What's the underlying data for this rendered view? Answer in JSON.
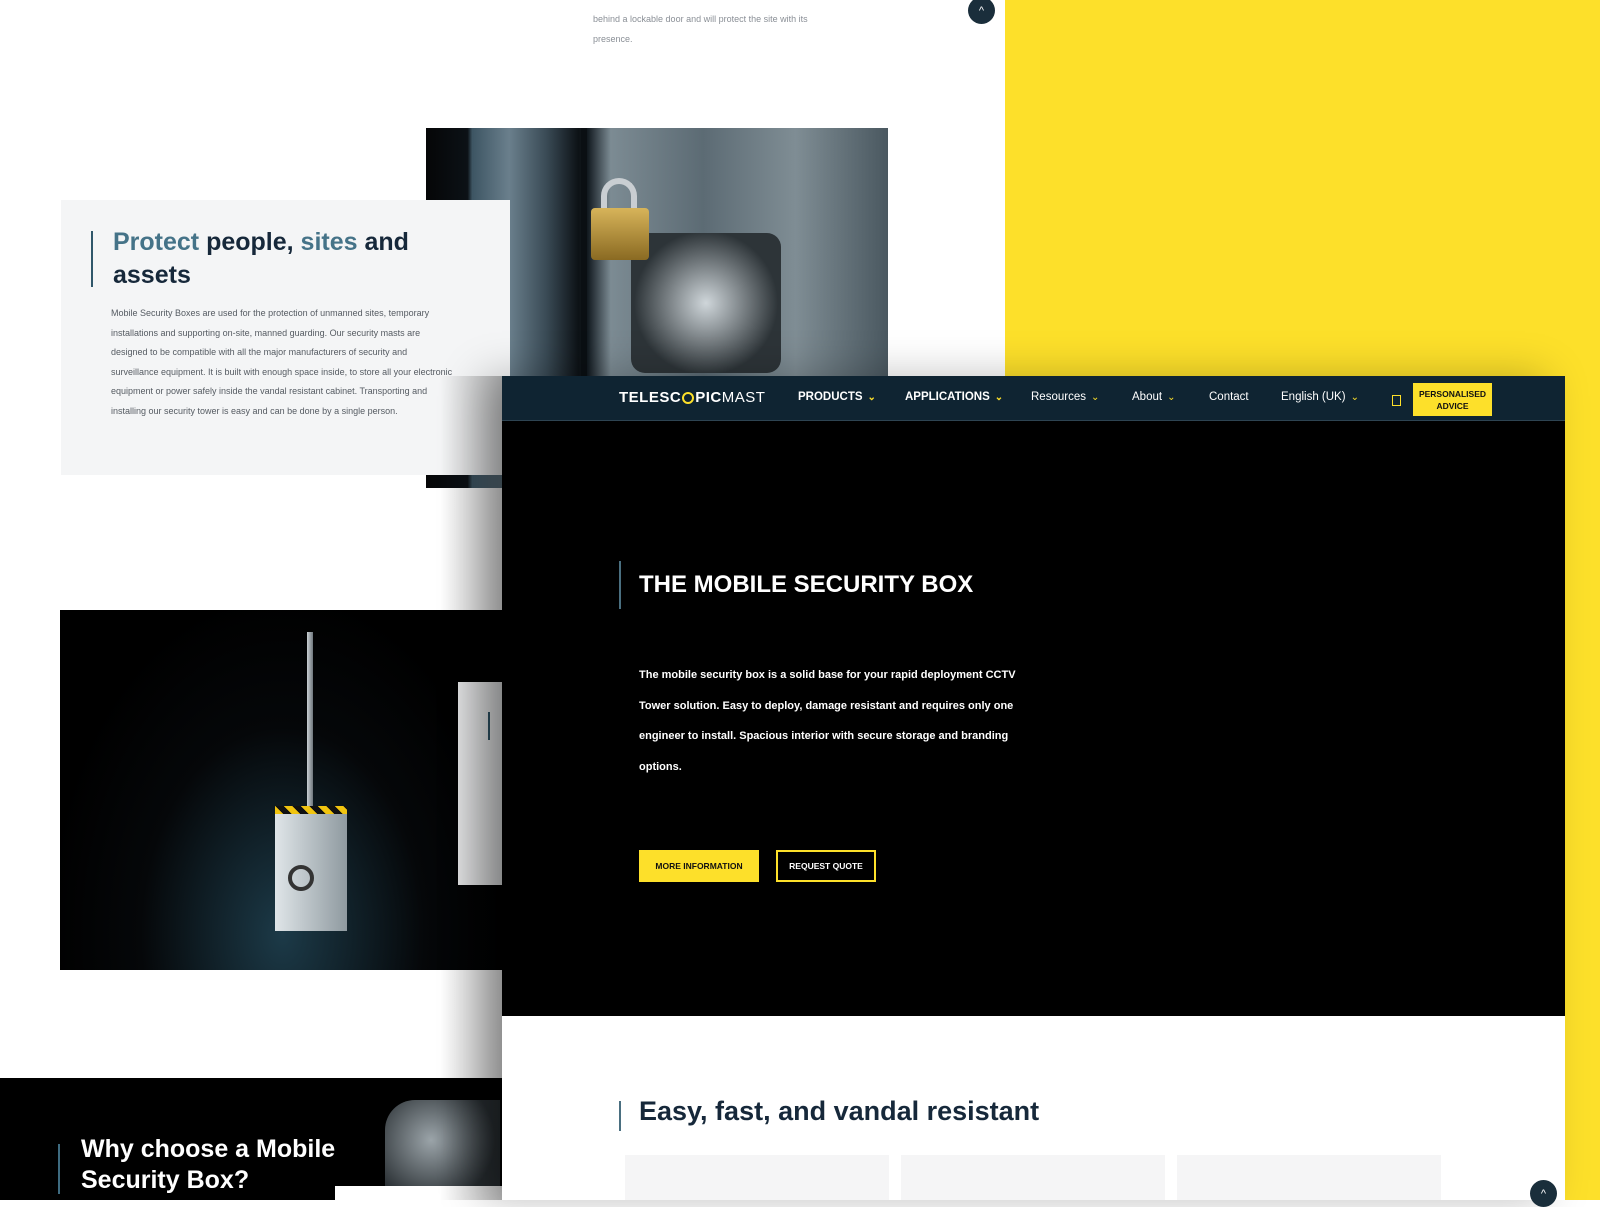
{
  "colors": {
    "accent": "#fde02a",
    "navy": "#0f2432",
    "hero_bg": "#000000",
    "highlight": "#457388"
  },
  "back_page": {
    "intro_text": "behind a lockable door and will protect the site with its presence.",
    "protect_card": {
      "title_w1": "Protect",
      "title_w2": " people, ",
      "title_w3": "sites",
      "title_w4": " and assets",
      "body": "Mobile Security Boxes are used for the protection of unmanned sites, temporary installations and supporting on-site, manned guarding. Our security masts are designed to be compatible with all the major manufacturers of security and surveillance equipment. It is built with enough space inside, to store all your electronic equipment or power safely inside the vandal resistant cabinet. Transporting and installing our security tower is easy and can be done by a single person."
    },
    "why_title": "Why choose a Mobile Security Box?",
    "scroll_top_icon": "chevron-up-icon"
  },
  "front_page": {
    "nav": {
      "logo_bold_1": "TELESC",
      "logo_bold_2": "PIC",
      "logo_light": "MAST",
      "items": [
        {
          "label": "PRODUCTS"
        },
        {
          "label": "APPLICATIONS"
        },
        {
          "label": "Resources"
        },
        {
          "label": "About"
        },
        {
          "label": "Contact"
        },
        {
          "label": "English (UK)"
        }
      ],
      "chevron": "⌄",
      "doc_icon": "document-icon",
      "advice_label": "PERSONALISED ADVICE"
    },
    "hero": {
      "title": "THE MOBILE SECURITY BOX",
      "description": "The mobile security box is a solid base for your rapid deployment CCTV Tower solution. Easy to deploy, damage resistant and requires only one engineer to install. Spacious interior with secure storage and branding options.",
      "btn_more": "MORE INFORMATION",
      "btn_quote": "REQUEST QUOTE"
    },
    "section_title": "Easy, fast, and vandal resistant",
    "scroll_top": "^"
  }
}
